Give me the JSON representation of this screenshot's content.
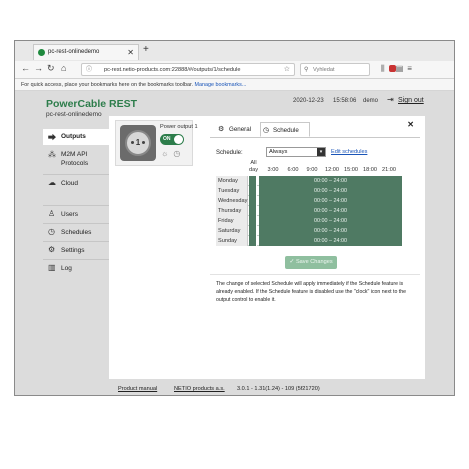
{
  "browser": {
    "tab_title": "pc-rest-onlinedemo",
    "new_tab_icon": "+",
    "url": "pc-rest.netio-products.com:22888/#/outputs/1/schedule",
    "search_placeholder": "Vyhledat",
    "bookmarks_text": "For quick access, place your bookmarks here on the bookmarks toolbar.",
    "bookmarks_link": "Manage bookmarks..."
  },
  "header": {
    "brand": "PowerCable REST",
    "hostname": "pc-rest-onlinedemo",
    "date": "2020-12-23",
    "time": "15:58:06",
    "user": "demo",
    "signout_label": "Sign out"
  },
  "sidebar": {
    "items": [
      {
        "label": "Outputs",
        "icon": "outputs-icon",
        "active": true
      },
      {
        "label": "M2M API",
        "sub": "Protocols",
        "icon": "m2m-icon",
        "active": false
      },
      {
        "label": "Cloud",
        "icon": "cloud-icon",
        "active": false
      },
      {
        "label": "Users",
        "icon": "users-icon",
        "active": false
      },
      {
        "label": "Schedules",
        "icon": "schedules-icon",
        "active": false
      },
      {
        "label": "Settings",
        "icon": "settings-icon",
        "active": false
      },
      {
        "label": "Log",
        "icon": "log-icon",
        "active": false
      }
    ]
  },
  "output": {
    "number": "1",
    "name": "Power output 1",
    "state_label": "ON"
  },
  "panel": {
    "tabs": [
      "General",
      "Schedule"
    ],
    "active_tab": "Schedule",
    "close_icon": "✕",
    "schedule_label": "Schedule:",
    "schedule_value": "Always",
    "edit_link": "Edit schedules",
    "grid": {
      "all_day_header": "All day",
      "hours": [
        "3:00",
        "6:00",
        "9:00",
        "12:00",
        "15:00",
        "18:00",
        "21:00"
      ],
      "days": [
        "Monday",
        "Tuesday",
        "Wednesday",
        "Thursday",
        "Friday",
        "Saturday",
        "Sunday"
      ],
      "slot_label": "00:00 – 24:00"
    },
    "save_label": "Save Changes",
    "note": "The change of selected Schedule will apply immediately if the Schedule feature is already enabled. If the Schedule feature is disabled use the \"clock\" icon next to the output control to enable it."
  },
  "footer": {
    "product_manual": "Product manual",
    "company": "NETIO products a.s.",
    "version": "3.0.1 - 1.31(1.24) - 109 (5f21720)"
  }
}
